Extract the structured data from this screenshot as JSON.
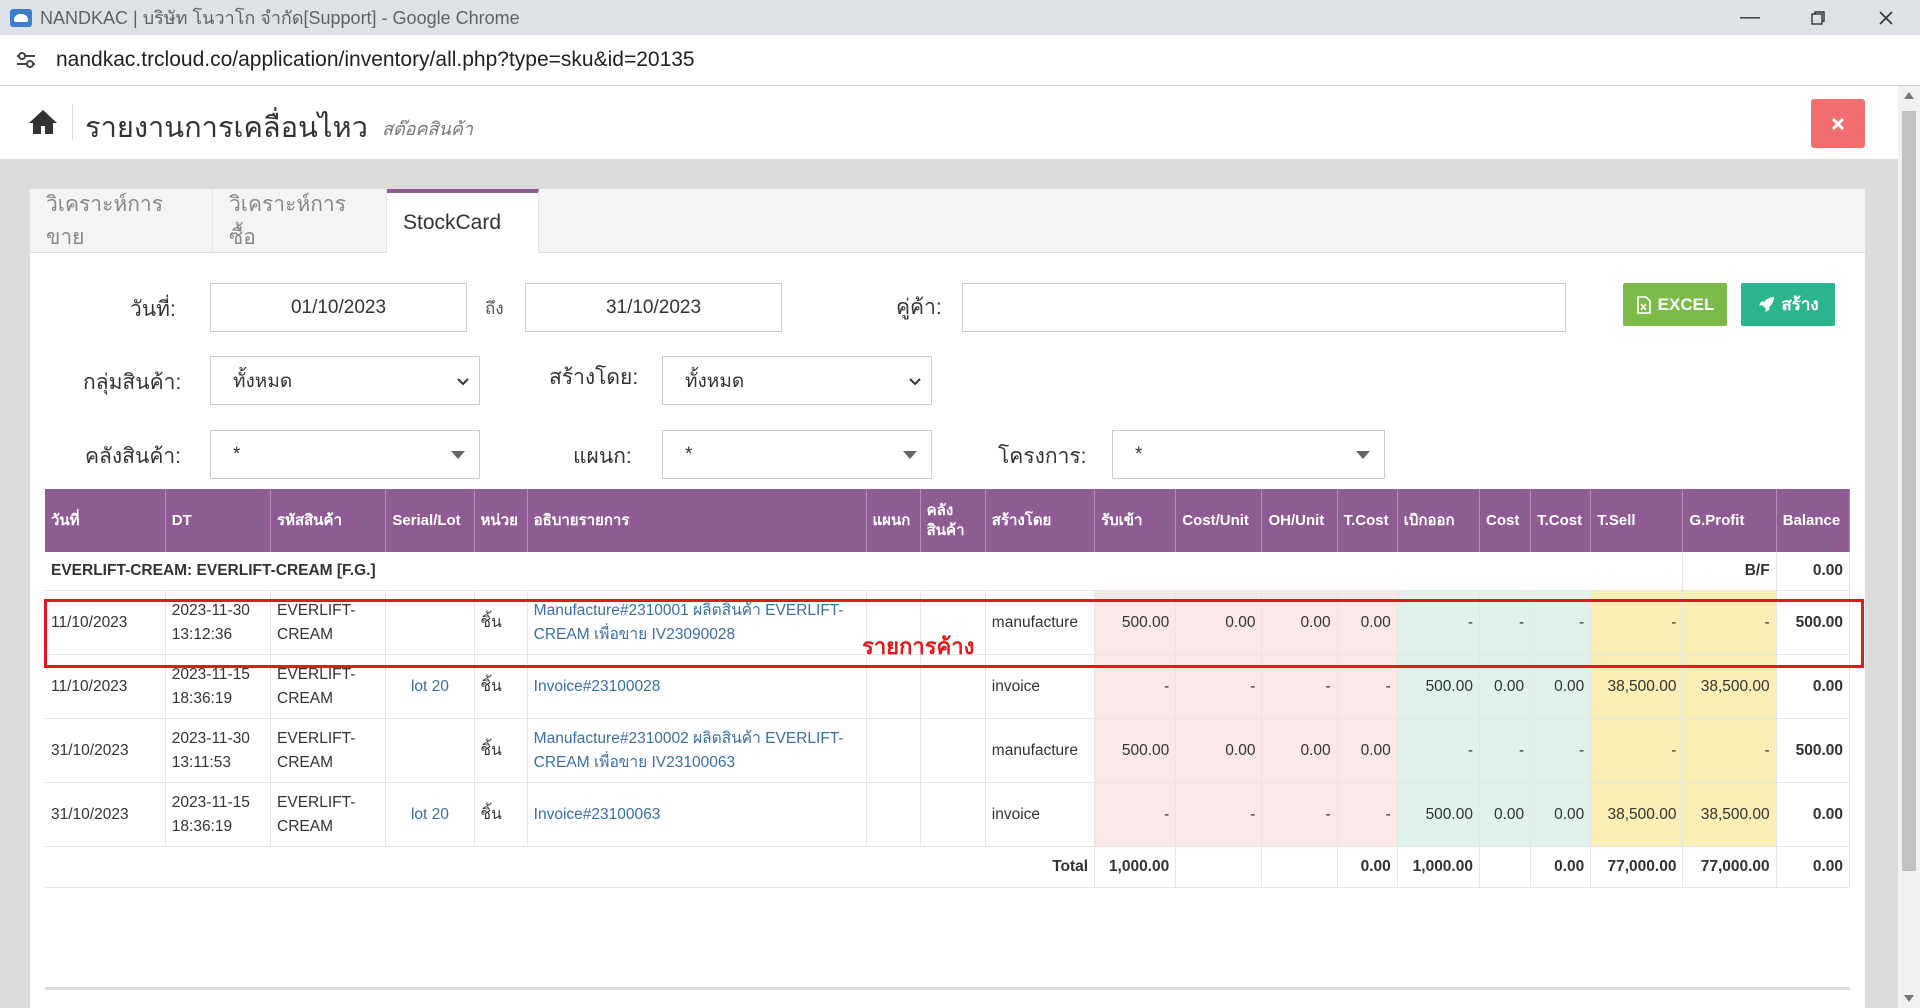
{
  "browser": {
    "window_title": "NANDKAC | บริษัท โนวาโก จำกัด[Support] - Google Chrome",
    "url": "nandkac.trcloud.co/application/inventory/all.php?type=sku&id=20135"
  },
  "header": {
    "title": "รายงานการเคลื่อนไหว",
    "subtitle": "สต๊อคสินค้า"
  },
  "tabs": [
    {
      "label": "วิเคราะห์การขาย"
    },
    {
      "label": "วิเคราะห์การซื้อ"
    },
    {
      "label": "StockCard"
    }
  ],
  "filters": {
    "date_label": "วันที่:",
    "date_from": "01/10/2023",
    "to_label": "ถึง",
    "date_to": "31/10/2023",
    "partner_label": "คู่ค้า:",
    "partner_value": "",
    "group_label": "กลุ่มสินค้า:",
    "group_value": "ทั้งหมด",
    "created_by_label": "สร้างโดย:",
    "created_by_value": "ทั้งหมด",
    "warehouse_label": "คลังสินค้า:",
    "warehouse_value": "*",
    "department_label": "แผนก:",
    "department_value": "*",
    "project_label": "โครงการ:",
    "project_value": "*"
  },
  "buttons": {
    "excel": "EXCEL",
    "create": "สร้าง"
  },
  "table": {
    "headers": [
      "วันที่",
      "DT",
      "รหัสสินค้า",
      "Serial/Lot",
      "หน่วย",
      "อธิบายรายการ",
      "แผนก",
      "คลังสินค้า",
      "สร้างโดย",
      "รับเข้า",
      "Cost/Unit",
      "OH/Unit",
      "T.Cost",
      "เบิกออก",
      "Cost",
      "T.Cost",
      "T.Sell",
      "G.Profit",
      "Balance"
    ],
    "group_row": {
      "label": "EVERLIFT-CREAM: EVERLIFT-CREAM [F.G.]",
      "bf_label": "B/F",
      "bf_value": "0.00"
    },
    "rows": [
      {
        "date": "11/10/2023",
        "dt1": "2023-11-30",
        "dt2": "13:12:36",
        "code1": "EVERLIFT-",
        "code2": "CREAM",
        "lot": "",
        "unit": "ชิ้น",
        "desc": "Manufacture#2310001 ผลิตสินค้า EVERLIFT-CREAM เพื่อขาย IV23090028",
        "dept": "",
        "wh": "",
        "by": "manufacture",
        "in": "500.00",
        "cost_unit": "0.00",
        "oh_unit": "0.00",
        "t_cost_in": "0.00",
        "out": "-",
        "cost": "-",
        "t_cost_out": "-",
        "t_sell": "-",
        "g_profit": "-",
        "balance": "500.00"
      },
      {
        "date": "11/10/2023",
        "dt1": "2023-11-15",
        "dt2": "18:36:19",
        "code1": "EVERLIFT-",
        "code2": "CREAM",
        "lot": "lot 20",
        "unit": "ชิ้น",
        "desc": "Invoice#23100028",
        "dept": "",
        "wh": "",
        "by": "invoice",
        "in": "-",
        "cost_unit": "-",
        "oh_unit": "-",
        "t_cost_in": "-",
        "out": "500.00",
        "cost": "0.00",
        "t_cost_out": "0.00",
        "t_sell": "38,500.00",
        "g_profit": "38,500.00",
        "balance": "0.00"
      },
      {
        "date": "31/10/2023",
        "dt1": "2023-11-30",
        "dt2": "13:11:53",
        "code1": "EVERLIFT-",
        "code2": "CREAM",
        "lot": "",
        "unit": "ชิ้น",
        "desc": "Manufacture#2310002 ผลิตสินค้า EVERLIFT-CREAM เพื่อขาย IV23100063",
        "dept": "",
        "wh": "",
        "by": "manufacture",
        "in": "500.00",
        "cost_unit": "0.00",
        "oh_unit": "0.00",
        "t_cost_in": "0.00",
        "out": "-",
        "cost": "-",
        "t_cost_out": "-",
        "t_sell": "-",
        "g_profit": "-",
        "balance": "500.00"
      },
      {
        "date": "31/10/2023",
        "dt1": "2023-11-15",
        "dt2": "18:36:19",
        "code1": "EVERLIFT-",
        "code2": "CREAM",
        "lot": "lot 20",
        "unit": "ชิ้น",
        "desc": "Invoice#23100063",
        "dept": "",
        "wh": "",
        "by": "invoice",
        "in": "-",
        "cost_unit": "-",
        "oh_unit": "-",
        "t_cost_in": "-",
        "out": "500.00",
        "cost": "0.00",
        "t_cost_out": "0.00",
        "t_sell": "38,500.00",
        "g_profit": "38,500.00",
        "balance": "0.00"
      }
    ],
    "total": {
      "label": "Total",
      "in": "1,000.00",
      "t_cost_in": "0.00",
      "out": "1,000.00",
      "t_cost_out": "0.00",
      "t_sell": "77,000.00",
      "g_profit": "77,000.00",
      "balance": "0.00"
    }
  },
  "annotation": "รายการค้าง",
  "colors": {
    "header_purple": "#8e5c93",
    "highlight_red": "#e11b1b",
    "excel_green": "#7cbb4a",
    "create_teal": "#2bb58e",
    "close_red": "#f26d6d"
  }
}
